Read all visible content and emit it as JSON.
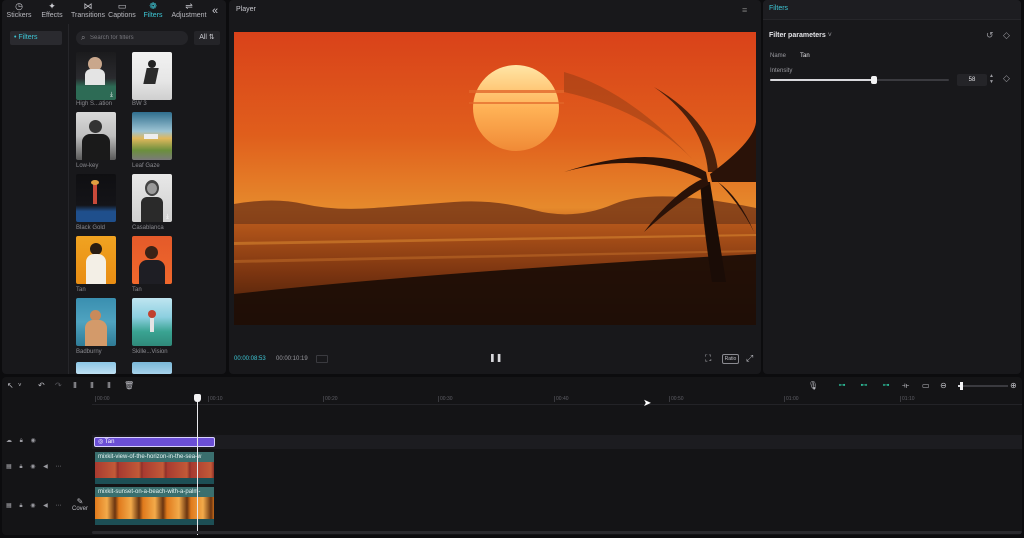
{
  "tabs": [
    {
      "label": "Stickers",
      "icon": "stickers-icon",
      "glyph": "◷",
      "active": false
    },
    {
      "label": "Effects",
      "icon": "effects-icon",
      "glyph": "✦",
      "active": false
    },
    {
      "label": "Transitions",
      "icon": "transitions-icon",
      "glyph": "⋈",
      "active": false
    },
    {
      "label": "Captions",
      "icon": "captions-icon",
      "glyph": "▭",
      "active": false
    },
    {
      "label": "Filters",
      "icon": "filters-icon",
      "glyph": "❁",
      "active": true
    },
    {
      "label": "Adjustment",
      "icon": "adjustment-icon",
      "glyph": "⇌",
      "active": false
    }
  ],
  "left_nav": {
    "item": "• Filters"
  },
  "search": {
    "placeholder": "Search for filters"
  },
  "filter_scope": "All",
  "filters": [
    {
      "label": "High S...ation"
    },
    {
      "label": "BW 3"
    },
    {
      "label": "Low-key"
    },
    {
      "label": "Leaf Gaze"
    },
    {
      "label": "Black Gold"
    },
    {
      "label": "Casablanca"
    },
    {
      "label": "Tan"
    },
    {
      "label": "Tan"
    },
    {
      "label": "Badburny"
    },
    {
      "label": "Skille...Vision"
    }
  ],
  "player": {
    "title": "Player",
    "current_time": "00:00:08:53",
    "total_time": "00:00:10:19",
    "ratio_label": "Ratio"
  },
  "right_panel": {
    "tab": "Filters",
    "section_title": "Filter parameters",
    "name_label": "Name",
    "name_value": "Tan",
    "intensity_label": "Intensity",
    "intensity_value": "58",
    "intensity_fraction": 0.58
  },
  "timeline": {
    "ruler_ticks": [
      "00:00",
      "00:10",
      "00:20",
      "00:30",
      "00:40",
      "00:50",
      "01:00",
      "01:10"
    ],
    "filter_clip_label": "Tan",
    "clip1_title": "mixkit-view-of-the-horizon-in-the-sea-w",
    "clip2_title": "mixkit-sunset-on-a-beach-with-a-palm-",
    "cover_label": "Cover",
    "zoom_fraction": 0.04
  },
  "colors": {
    "accent": "#3ec7d6",
    "filter_clip": "#6b4fd6",
    "clip_header": "#3a6f6e",
    "panel_bg": "#18181b"
  }
}
